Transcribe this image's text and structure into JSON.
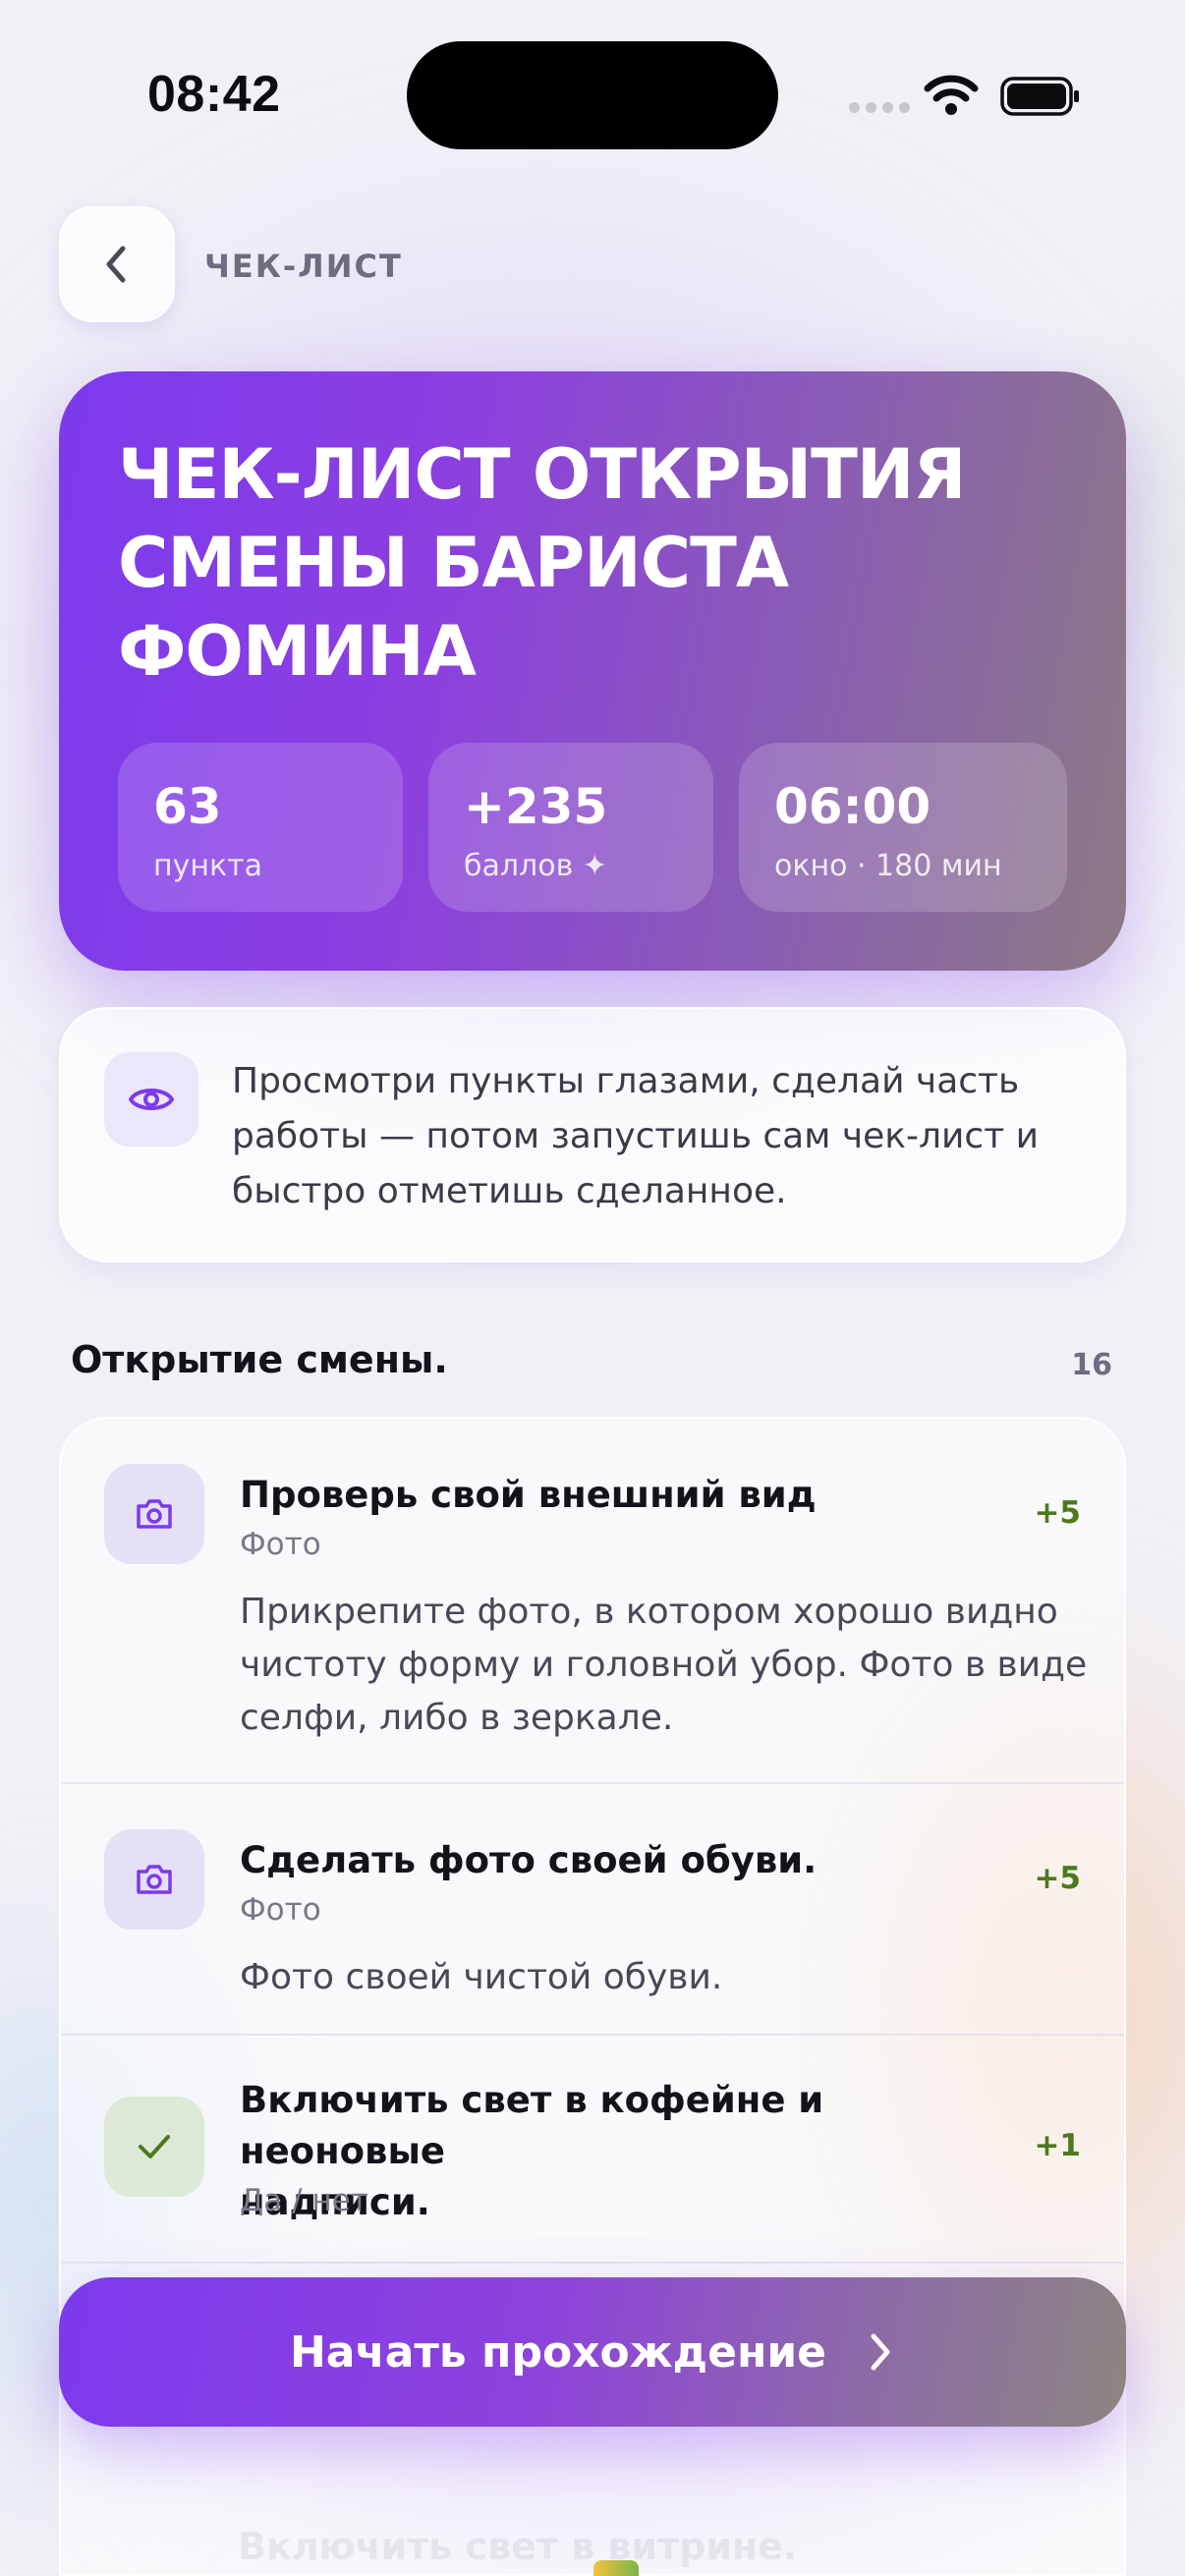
{
  "status_bar": {
    "time": "08:42"
  },
  "header": {
    "title": "ЧЕК-ЛИСТ"
  },
  "hero": {
    "title_lines": [
      "ЧЕК-ЛИСТ ОТКРЫТИЯ",
      "СМЕНЫ БАРИСТА",
      "ФОМИНА"
    ],
    "stats": [
      {
        "value": "63",
        "label": "пункта"
      },
      {
        "value": "+235",
        "label": "баллов ✦"
      },
      {
        "value": "06:00",
        "label": "окно · 180 мин"
      }
    ]
  },
  "info": {
    "icon": "eye-icon",
    "text_lines": [
      "Просмотри пункты глазами, сделай часть",
      "работы — потом запустишь сам чек-лист и",
      "быстро отметишь сделанное."
    ]
  },
  "section": {
    "title": "Открытие смены.",
    "count": "16"
  },
  "items": [
    {
      "icon": "camera-icon",
      "title_lines": [
        "Проверь свой внешний вид"
      ],
      "type": "Фото",
      "points": "+5",
      "desc_lines": [
        "Прикрепите фото, в котором хорошо видно",
        "чистоту форму и головной убор. Фото в виде",
        "селфи, либо в зеркале."
      ]
    },
    {
      "icon": "camera-icon",
      "title_lines": [
        "Сделать фото своей обуви."
      ],
      "type": "Фото",
      "points": "+5",
      "desc_lines": [
        "Фото своей чистой обуви."
      ]
    },
    {
      "icon": "check-icon",
      "title_lines": [
        "Включить свет в кофейне и неоновые",
        "надписи."
      ],
      "type": "Да / нет",
      "points": "+1"
    },
    {
      "title_lines": [
        "Включить свет в витрине."
      ]
    }
  ],
  "cta": {
    "label": "Начать прохождение",
    "icon": "chevron-right-icon"
  },
  "colors": {
    "accent": "#7c3aed",
    "points": "#4d7a1c",
    "check": "#4d7a1c"
  }
}
